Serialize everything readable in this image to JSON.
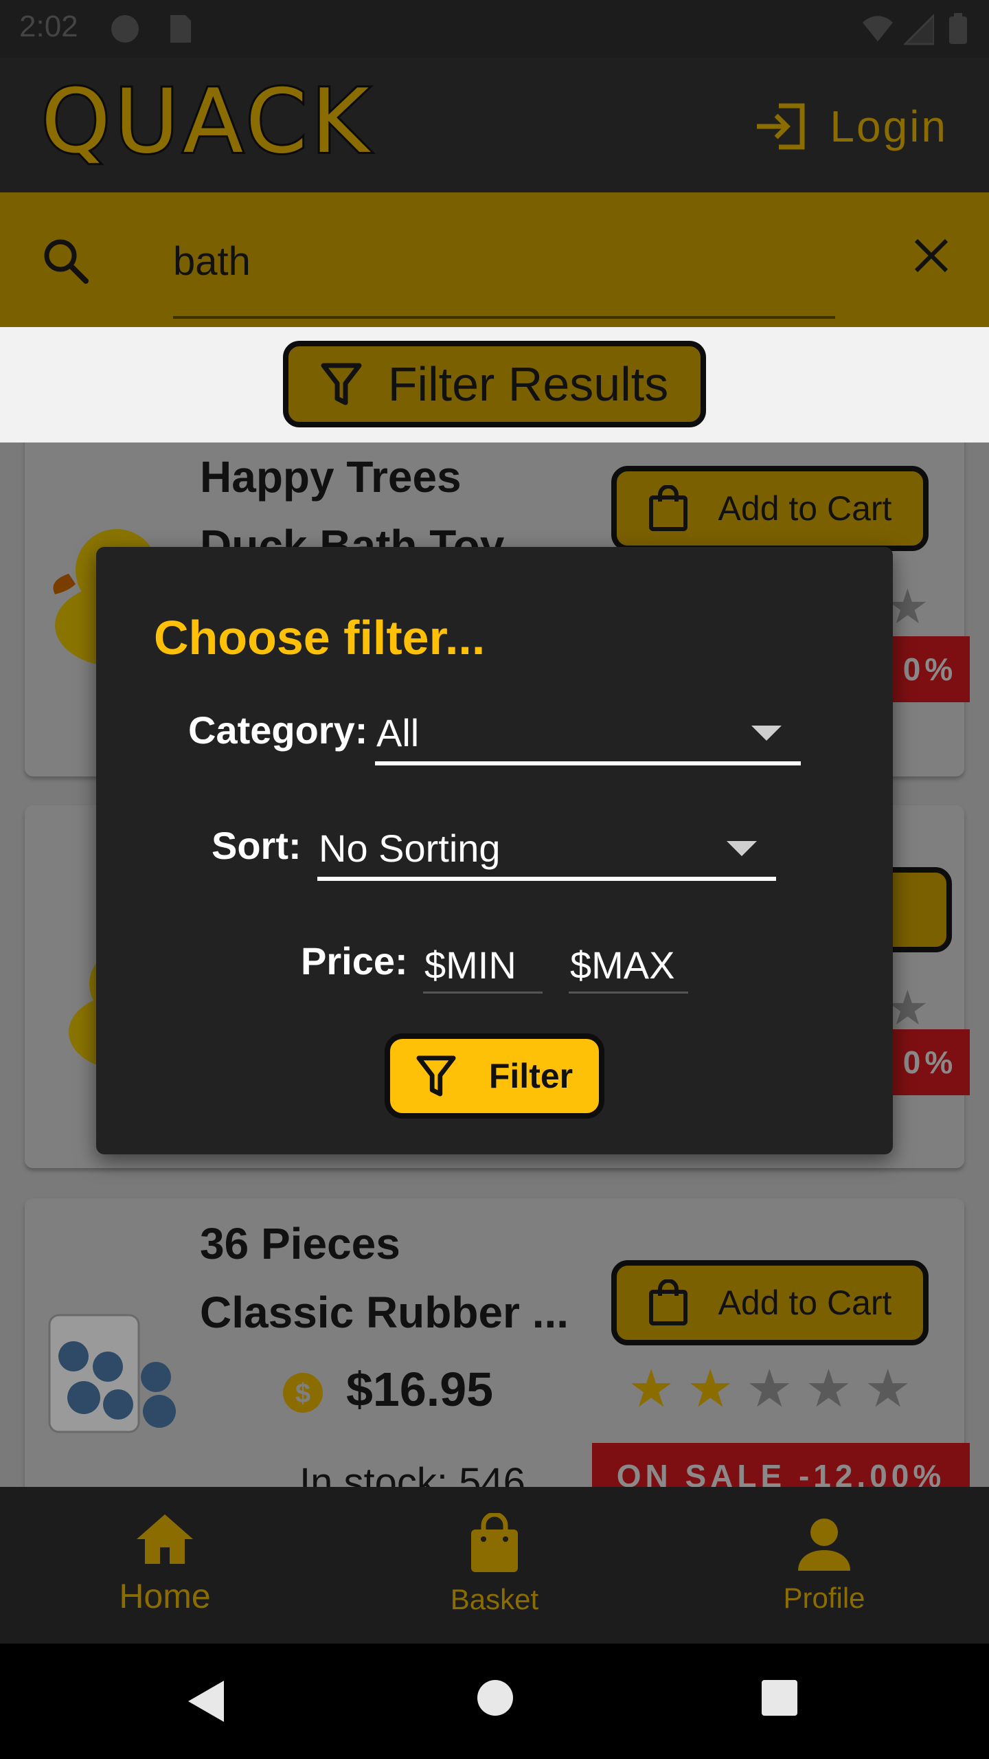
{
  "status_bar": {
    "time": "2:02"
  },
  "app_bar": {
    "logo": "QUACK",
    "login_label": "Login"
  },
  "search": {
    "value": "bath"
  },
  "filter_results_label": "Filter Results",
  "products": [
    {
      "title_line1": "Happy Trees",
      "title_line2": "Duck Bath Toy",
      "cart_label": "Add to Cart",
      "sale_label": "0%",
      "rating": 1
    },
    {
      "cart_label": "",
      "sale_label": "0%",
      "rating": 4
    },
    {
      "title_line1": "36 Pieces",
      "title_line2": "Classic Rubber ...",
      "price": "$16.95",
      "cart_label": "Add to Cart",
      "sale_label": "ON SALE -12.00%",
      "stock": "In stock: 546",
      "rating": 2
    }
  ],
  "dialog": {
    "title": "Choose filter...",
    "category_label": "Category:",
    "category_value": "All",
    "sort_label": "Sort:",
    "sort_value": "No Sorting",
    "price_label": "Price:",
    "min_placeholder": "$MIN",
    "max_placeholder": "$MAX",
    "filter_button": "Filter"
  },
  "bottom_nav": {
    "home": "Home",
    "basket": "Basket",
    "profile": "Profile"
  },
  "colors": {
    "accent": "#ffc107",
    "dim_accent": "#7b6000",
    "dialog_bg": "#222222",
    "sale_red": "#7d0f12"
  }
}
